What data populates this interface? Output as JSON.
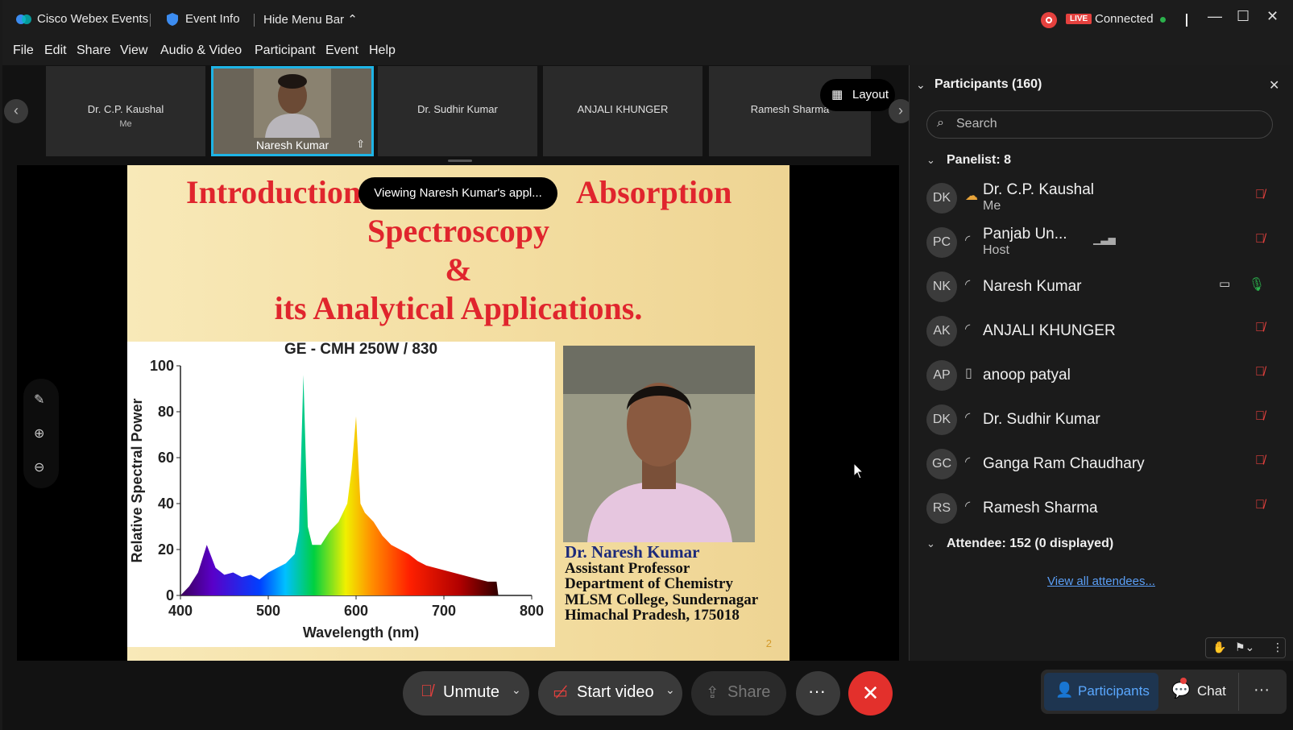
{
  "titlebar": {
    "app_name": "Cisco Webex Events",
    "event_info": "Event Info",
    "hide_menu": "Hide Menu Bar",
    "live": "LIVE",
    "status": "Connected"
  },
  "menu": [
    "File",
    "Edit",
    "Share",
    "View",
    "Audio & Video",
    "Participant",
    "Event",
    "Help"
  ],
  "filmstrip": {
    "tiles": [
      {
        "name": "Dr. C.P. Kaushal",
        "sub": "Me"
      },
      {
        "name": "Naresh Kumar",
        "sub": ""
      },
      {
        "name": "Dr. Sudhir Kumar",
        "sub": ""
      },
      {
        "name": "ANJALI KHUNGER",
        "sub": ""
      },
      {
        "name": "Ramesh Sharma",
        "sub": ""
      }
    ],
    "layout_label": "Layout"
  },
  "toast": "Viewing Naresh Kumar's appl...",
  "slide": {
    "title_line1a": "Introduction",
    "title_line1b": "Absorption",
    "title_line2": "Spectroscopy",
    "title_line3": "&",
    "title_line4": "its Analytical Applications.",
    "author_name": "Dr. Naresh  Kumar",
    "author_lines": [
      "Assistant Professor",
      "Department of Chemistry",
      "MLSM College, Sundernagar",
      "Himachal Pradesh, 175018"
    ],
    "page_number": "2"
  },
  "chart_data": {
    "type": "area",
    "title": "GE - CMH 250W / 830",
    "xlabel": "Wavelength (nm)",
    "ylabel": "Relative Spectral Power",
    "x_ticks": [
      "400",
      "500",
      "600",
      "700",
      "800"
    ],
    "y_ticks": [
      "0",
      "20",
      "40",
      "60",
      "80",
      "100"
    ],
    "xlim": [
      400,
      800
    ],
    "ylim": [
      0,
      100
    ],
    "x": [
      400,
      410,
      420,
      430,
      440,
      450,
      460,
      470,
      480,
      490,
      500,
      510,
      520,
      530,
      535,
      540,
      545,
      550,
      560,
      570,
      580,
      590,
      595,
      600,
      605,
      610,
      620,
      630,
      640,
      650,
      660,
      670,
      680,
      690,
      700,
      710,
      720,
      730,
      740,
      750,
      760,
      762
    ],
    "y": [
      0,
      4,
      10,
      22,
      12,
      9,
      10,
      8,
      9,
      7,
      10,
      12,
      14,
      18,
      28,
      96,
      30,
      22,
      22,
      28,
      32,
      40,
      55,
      78,
      40,
      36,
      32,
      26,
      22,
      20,
      18,
      15,
      13,
      12,
      11,
      10,
      9,
      8,
      7,
      6,
      6,
      0
    ]
  },
  "participants": {
    "title": "Participants (160)",
    "search_placeholder": "Search",
    "panelist_header": "Panelist: 8",
    "panelists": [
      {
        "initials": "DK",
        "name": "Dr. C.P. Kaushal",
        "role": "Me",
        "mic": "off"
      },
      {
        "initials": "PC",
        "name": "Panjab Un...",
        "role": "Host",
        "mic": "off"
      },
      {
        "initials": "NK",
        "name": "Naresh Kumar",
        "role": "",
        "mic": "on"
      },
      {
        "initials": "AK",
        "name": "ANJALI KHUNGER",
        "role": "",
        "mic": "off"
      },
      {
        "initials": "AP",
        "name": "anoop patyal",
        "role": "",
        "mic": "off"
      },
      {
        "initials": "DK",
        "name": "Dr. Sudhir Kumar",
        "role": "",
        "mic": "off"
      },
      {
        "initials": "GC",
        "name": "Ganga Ram Chaudhary",
        "role": "",
        "mic": "off"
      },
      {
        "initials": "RS",
        "name": "Ramesh Sharma",
        "role": "",
        "mic": "off"
      }
    ],
    "attendee_header": "Attendee: 152 (0 displayed)",
    "view_all": "View all attendees..."
  },
  "controls": {
    "unmute": "Unmute",
    "start_video": "Start video",
    "share": "Share",
    "participants": "Participants",
    "chat": "Chat"
  },
  "colors": {
    "accent": "#1eb4e6",
    "end": "#e3302c",
    "live": "#e5413e",
    "link": "#5a9ef5"
  }
}
